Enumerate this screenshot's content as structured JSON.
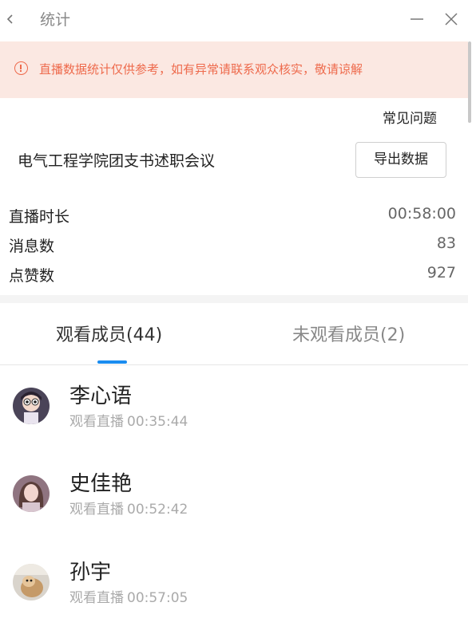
{
  "window": {
    "title": "统计"
  },
  "banner": {
    "text": "直播数据统计仅供参考，如有异常请联系观众核实，敬请谅解",
    "color": "#ee6a4c",
    "background": "#fbe8e2"
  },
  "faq_label": "常见问题",
  "meeting_title": "电气工程学院团支书述职会议",
  "export_label": "导出数据",
  "stats": [
    {
      "label": "直播时长",
      "value": "00:58:00"
    },
    {
      "label": "消息数",
      "value": "83"
    },
    {
      "label": "点赞数",
      "value": "927"
    }
  ],
  "tabs": [
    {
      "label": "观看成员(44)",
      "active": true
    },
    {
      "label": "未观看成员(2)",
      "active": false
    }
  ],
  "accent_color": "#1a8cf0",
  "members": [
    {
      "name": "李心语",
      "watch_label": "观看直播",
      "watch_time": "00:35:44"
    },
    {
      "name": "史佳艳",
      "watch_label": "观看直播",
      "watch_time": "00:52:42"
    },
    {
      "name": "孙宇",
      "watch_label": "观看直播",
      "watch_time": "00:57:05"
    }
  ]
}
